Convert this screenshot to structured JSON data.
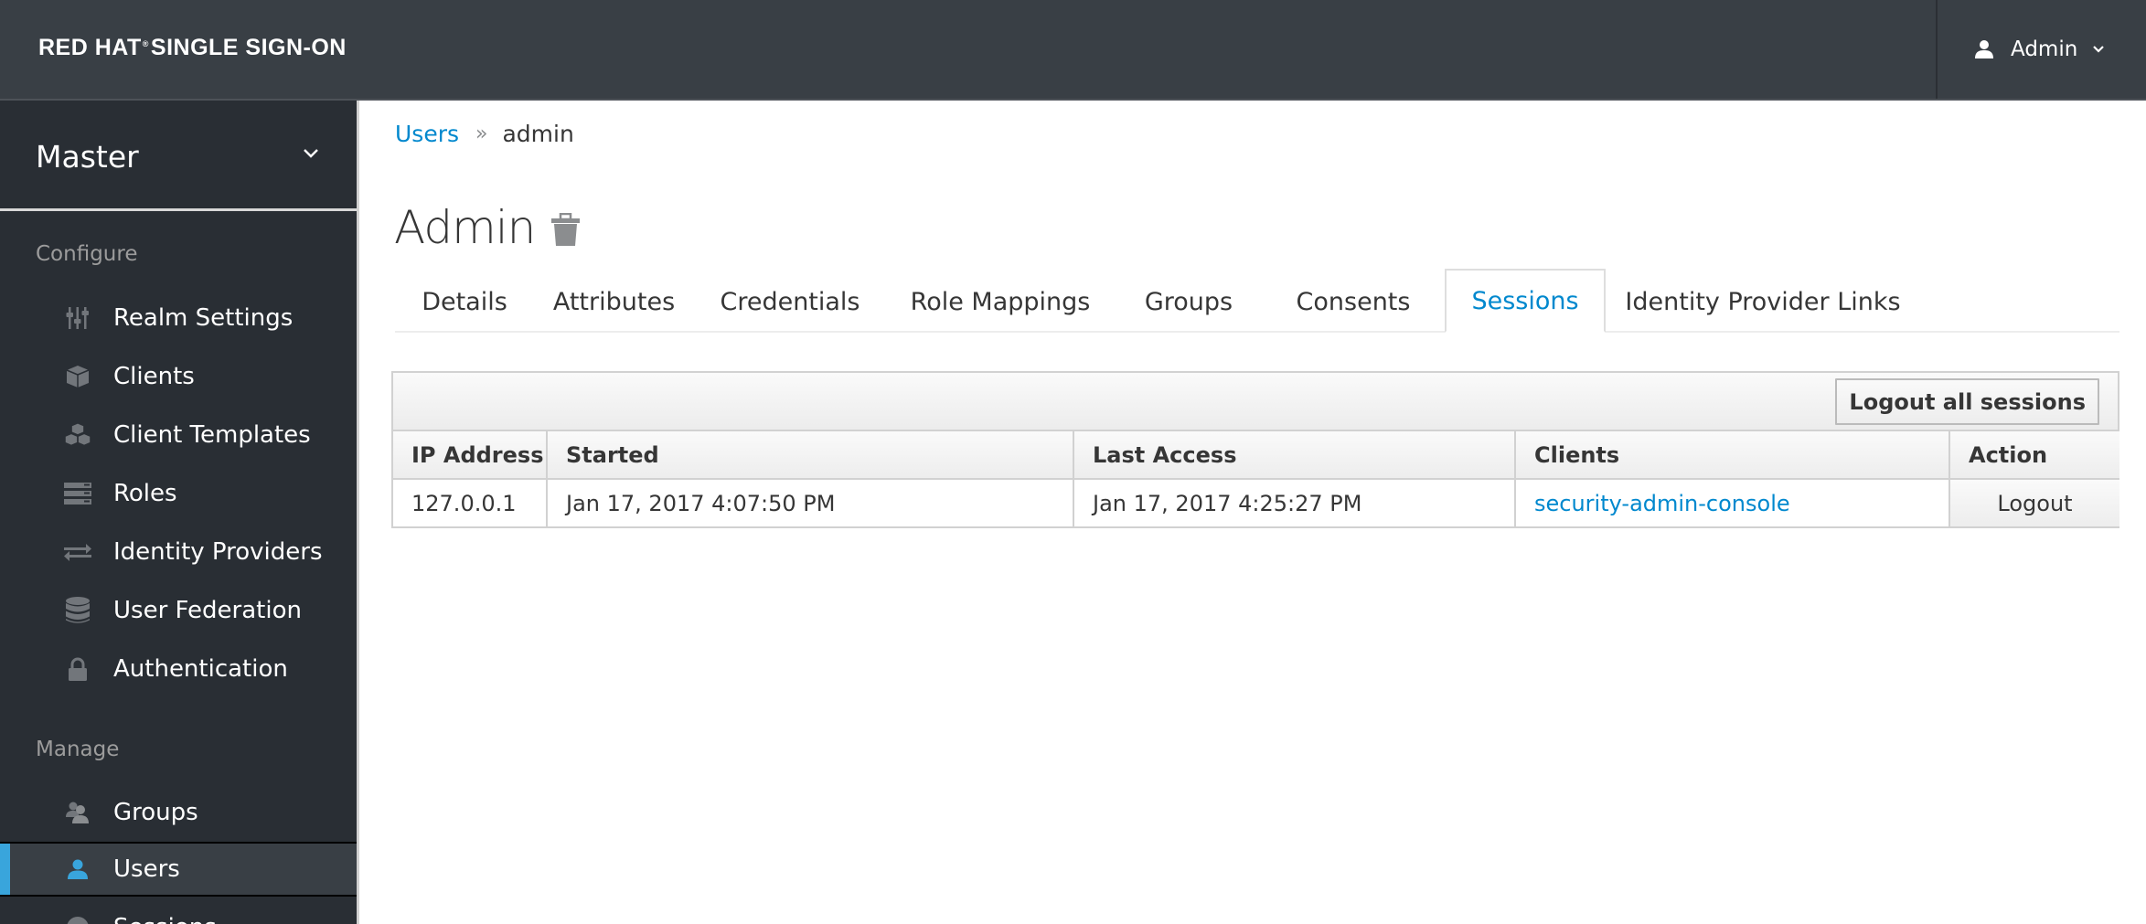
{
  "header": {
    "brand_bold": "RED HAT",
    "brand_rest": "SINGLE SIGN-ON",
    "user_label": "Admin",
    "user_icon": "user-icon",
    "user_chevron_icon": "chevron-down-icon"
  },
  "sidebar": {
    "realm": "Master",
    "sections": [
      {
        "title": "Configure",
        "items": [
          {
            "label": "Realm Settings",
            "icon": "sliders-icon"
          },
          {
            "label": "Clients",
            "icon": "cube-icon"
          },
          {
            "label": "Client Templates",
            "icon": "cubes-icon"
          },
          {
            "label": "Roles",
            "icon": "server-icon"
          },
          {
            "label": "Identity Providers",
            "icon": "exchange-icon"
          },
          {
            "label": "User Federation",
            "icon": "database-icon"
          },
          {
            "label": "Authentication",
            "icon": "lock-icon"
          }
        ]
      },
      {
        "title": "Manage",
        "items": [
          {
            "label": "Groups",
            "icon": "users-icon"
          },
          {
            "label": "Users",
            "icon": "user-icon",
            "active": true
          },
          {
            "label": "Sessions",
            "icon": "clock-icon"
          }
        ]
      }
    ]
  },
  "breadcrumb": {
    "parent": "Users",
    "separator": "»",
    "current": "admin"
  },
  "page": {
    "title": "Admin",
    "delete_icon": "trash-icon"
  },
  "tabs": [
    {
      "label": "Details"
    },
    {
      "label": "Attributes"
    },
    {
      "label": "Credentials"
    },
    {
      "label": "Role Mappings"
    },
    {
      "label": "Groups"
    },
    {
      "label": "Consents"
    },
    {
      "label": "Sessions",
      "active": true
    },
    {
      "label": "Identity Provider Links"
    }
  ],
  "sessions": {
    "logout_all_label": "Logout all sessions",
    "columns": [
      "IP Address",
      "Started",
      "Last Access",
      "Clients",
      "Action"
    ],
    "rows": [
      {
        "ip": "127.0.0.1",
        "started": "Jan 17, 2017 4:07:50 PM",
        "last_access": "Jan 17, 2017 4:25:27 PM",
        "client": "security-admin-console",
        "action": "Logout"
      }
    ]
  },
  "colors": {
    "header_bg": "#393f45",
    "sidebar_bg": "#292e34",
    "accent": "#0088ce",
    "active_indicator": "#39a5dc"
  }
}
